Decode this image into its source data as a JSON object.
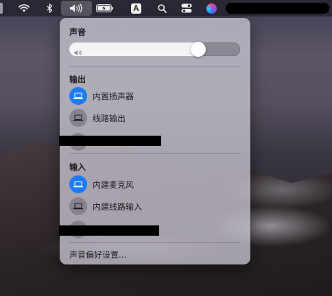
{
  "menubar": {
    "input_source_letter": "A"
  },
  "sound_panel": {
    "title": "声音",
    "volume_fraction": 0.78,
    "output": {
      "label": "输出",
      "devices": [
        {
          "label": "内置扬声器",
          "selected": true
        },
        {
          "label": "线路输出",
          "selected": false
        }
      ]
    },
    "input": {
      "label": "输入",
      "devices": [
        {
          "label": "内建麦克风",
          "selected": true
        },
        {
          "label": "内建线路输入",
          "selected": false
        }
      ]
    },
    "preferences_label": "声音偏好设置..."
  },
  "colors": {
    "accent": "#1f7cf0",
    "panel": "#c8c4d0"
  },
  "icons": {
    "wifi": "wifi-icon",
    "bluetooth": "bluetooth-icon",
    "volume": "volume-icon",
    "battery": "battery-icon",
    "search": "search-icon",
    "control_center": "control-center-icon",
    "siri": "siri-icon",
    "device": "laptop-icon"
  }
}
